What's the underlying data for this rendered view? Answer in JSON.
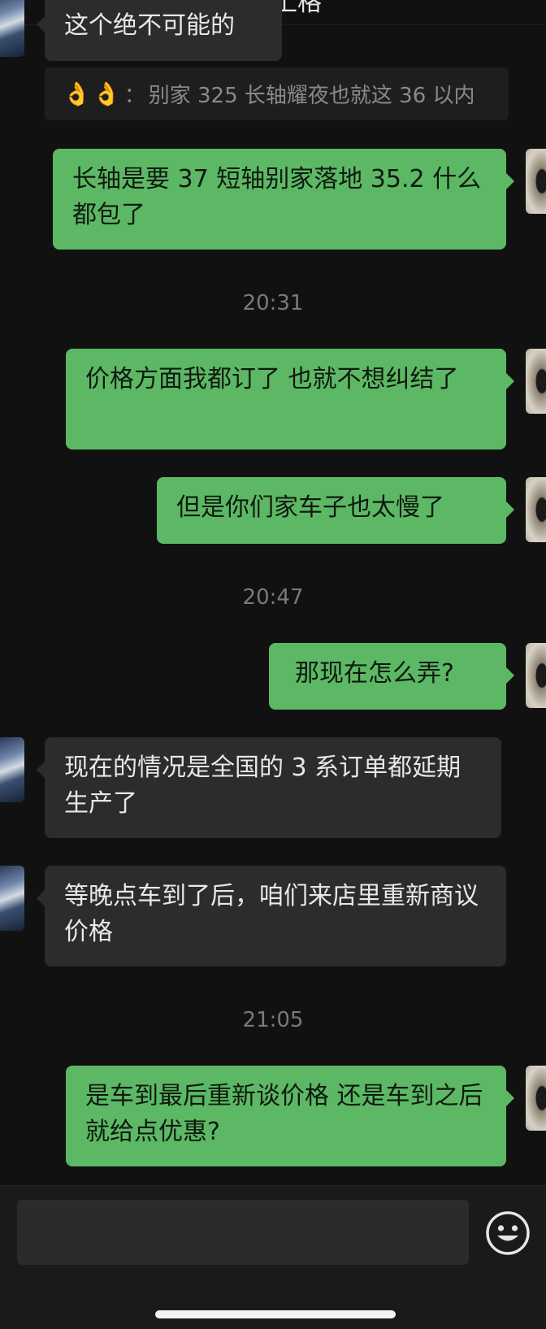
{
  "header": {
    "title": "报价上格"
  },
  "messages": {
    "m1": "这个绝不可能的",
    "quote": {
      "emoji": "👌👌",
      "separator": "：",
      "text": "别家 325 长轴耀夜也就这 36 以内"
    },
    "m2": "长轴是要 37 短轴别家落地 35.2 什么都包了",
    "t1": "20:31",
    "m3": "价格方面我都订了 也就不想纠结了",
    "m4": "但是你们家车子也太慢了",
    "t2": "20:47",
    "m5": "那现在怎么弄?",
    "m6": "现在的情况是全国的 3 系订单都延期生产了",
    "m7": "等晚点车到了后，咱们来店里重新商议价格",
    "t3": "21:05",
    "m8": "是车到最后重新谈价格 还是车到之后就给点优惠?"
  },
  "input": {
    "value": "",
    "placeholder": ""
  },
  "icons": {
    "emoji_button": "smiley-face-icon"
  },
  "colors": {
    "background": "#111111",
    "sent_bubble": "#5DB865",
    "received_bubble": "#2C2C2C",
    "timestamp": "#7A7A7A"
  }
}
